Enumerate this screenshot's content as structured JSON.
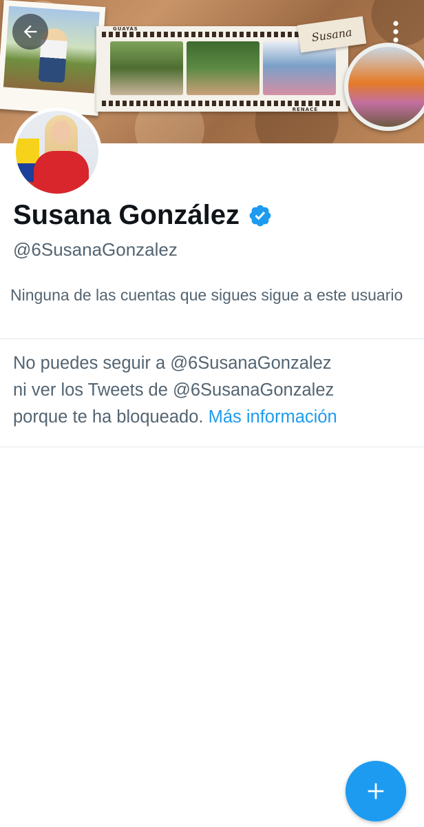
{
  "header": {
    "banner_tag_text": "Susana",
    "banner_label_top": "GUAYAS",
    "banner_label_bottom": "RENACE",
    "back_icon": "arrow-left-icon",
    "more_icon": "more-vertical-icon"
  },
  "profile": {
    "display_name": "Susana González",
    "verified": true,
    "verified_icon": "verified-badge-icon",
    "handle": "@6SusanaGonzalez",
    "followers_you_know": "Ninguna de las cuentas que sigues sigue a este usuario"
  },
  "blocked": {
    "line1": "No puedes seguir a @6SusanaGonzalez",
    "line2": "ni ver los Tweets de @6SusanaGonzalez",
    "line3_text": "porque te ha bloqueado.",
    "more_info_link": "Más información"
  },
  "fab": {
    "icon": "plus-icon"
  },
  "colors": {
    "accent": "#1d9bf0",
    "text_primary": "#0f1419",
    "text_secondary": "#536471",
    "divider": "#e1e6ea"
  }
}
